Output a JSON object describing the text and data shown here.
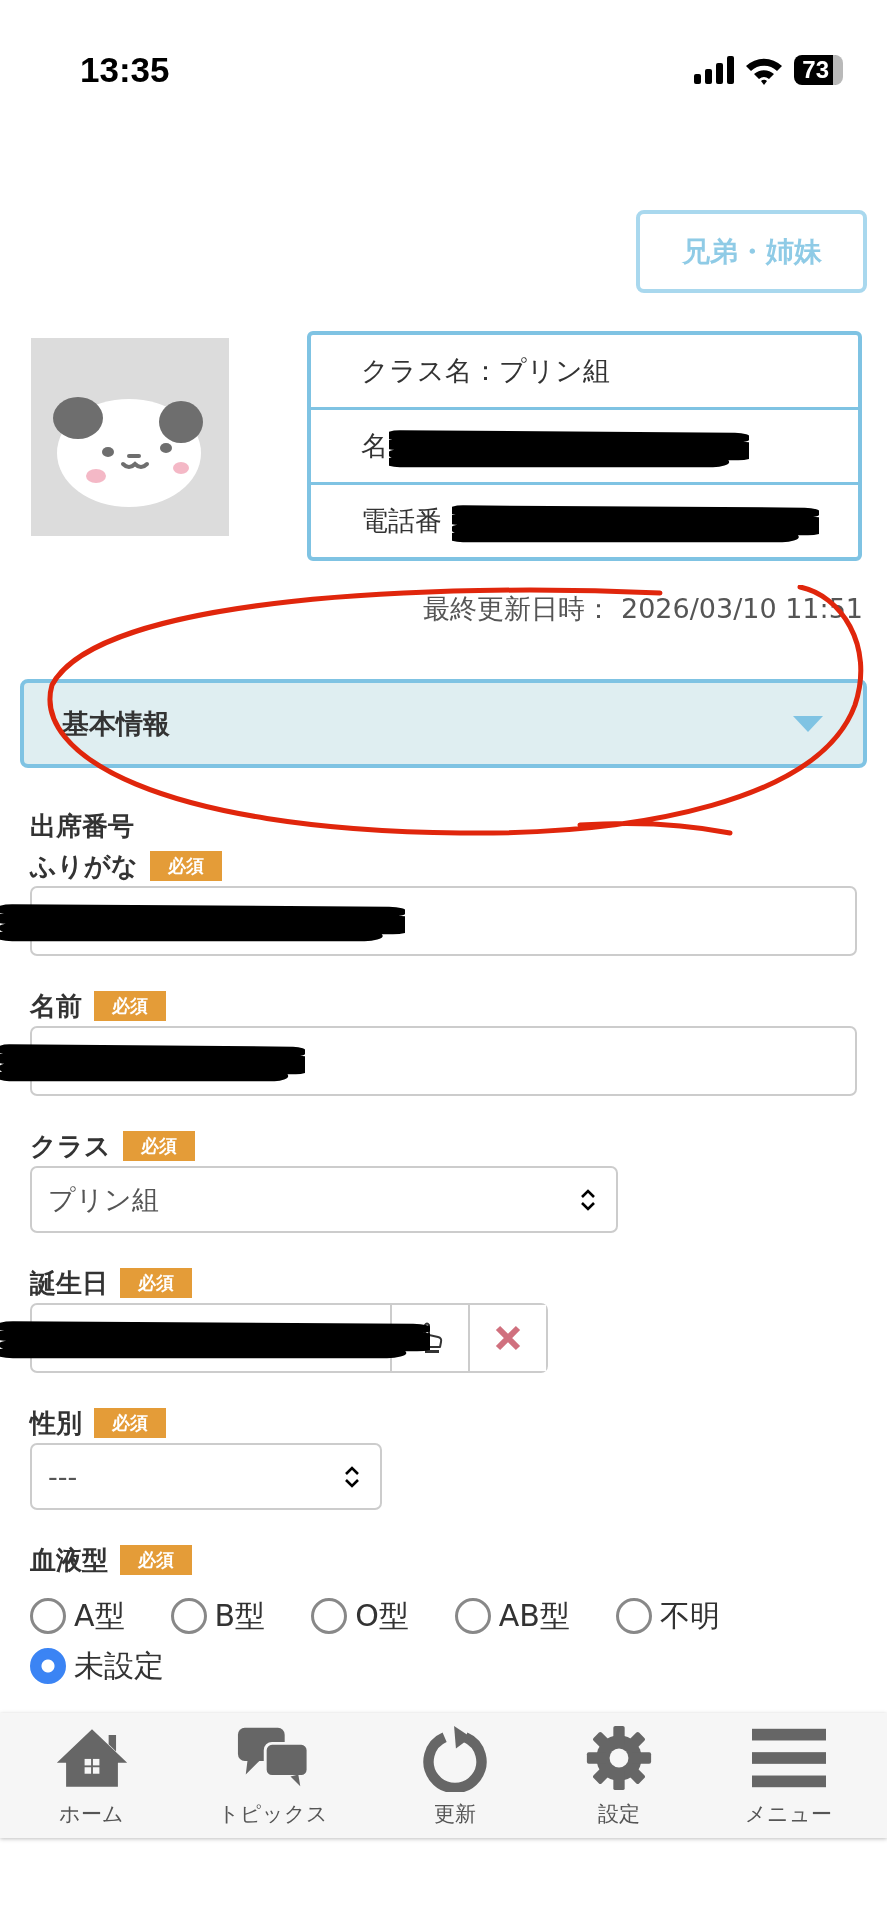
{
  "status_bar": {
    "time": "13:35",
    "battery": "73"
  },
  "sibling_button": {
    "label": "兄弟・姉妹"
  },
  "info_rows": [
    {
      "text": "クラス名：プリン組",
      "redacted": false
    },
    {
      "text": "名",
      "redacted": true
    },
    {
      "text": "電話番",
      "redacted": true
    }
  ],
  "last_updated": "最終更新日時： 2026/03/10 11:51",
  "section": {
    "title": "基本情報"
  },
  "fields": [
    {
      "kind": "label",
      "label": "出席番号"
    },
    {
      "kind": "text",
      "label": "ふりがな",
      "badge": "必須",
      "redacted": true
    },
    {
      "kind": "text",
      "label": "名前",
      "badge": "必須",
      "redacted": true
    },
    {
      "kind": "select",
      "label": "クラス",
      "badge": "必須",
      "value": "プリン組"
    },
    {
      "kind": "date",
      "label": "誕生日",
      "badge": "必須",
      "redacted": true
    },
    {
      "kind": "select",
      "label": "性別",
      "badge": "必須",
      "value": "---"
    },
    {
      "kind": "radio",
      "label": "血液型",
      "badge": "必須",
      "options": [
        {
          "label": "A型",
          "selected": false
        },
        {
          "label": "B型",
          "selected": false
        },
        {
          "label": "O型",
          "selected": false
        },
        {
          "label": "AB型",
          "selected": false
        },
        {
          "label": "不明",
          "selected": false
        },
        {
          "label": "未設定",
          "selected": true
        }
      ]
    }
  ],
  "annotations": [
    {
      "kind": "ellipse"
    }
  ],
  "tab_bar": [
    {
      "kind": "home",
      "label": "ホーム"
    },
    {
      "kind": "chat",
      "label": "トピックス"
    },
    {
      "kind": "refresh",
      "label": "更新"
    },
    {
      "kind": "gear",
      "label": "設定"
    },
    {
      "kind": "menu",
      "label": "メニュー"
    }
  ]
}
